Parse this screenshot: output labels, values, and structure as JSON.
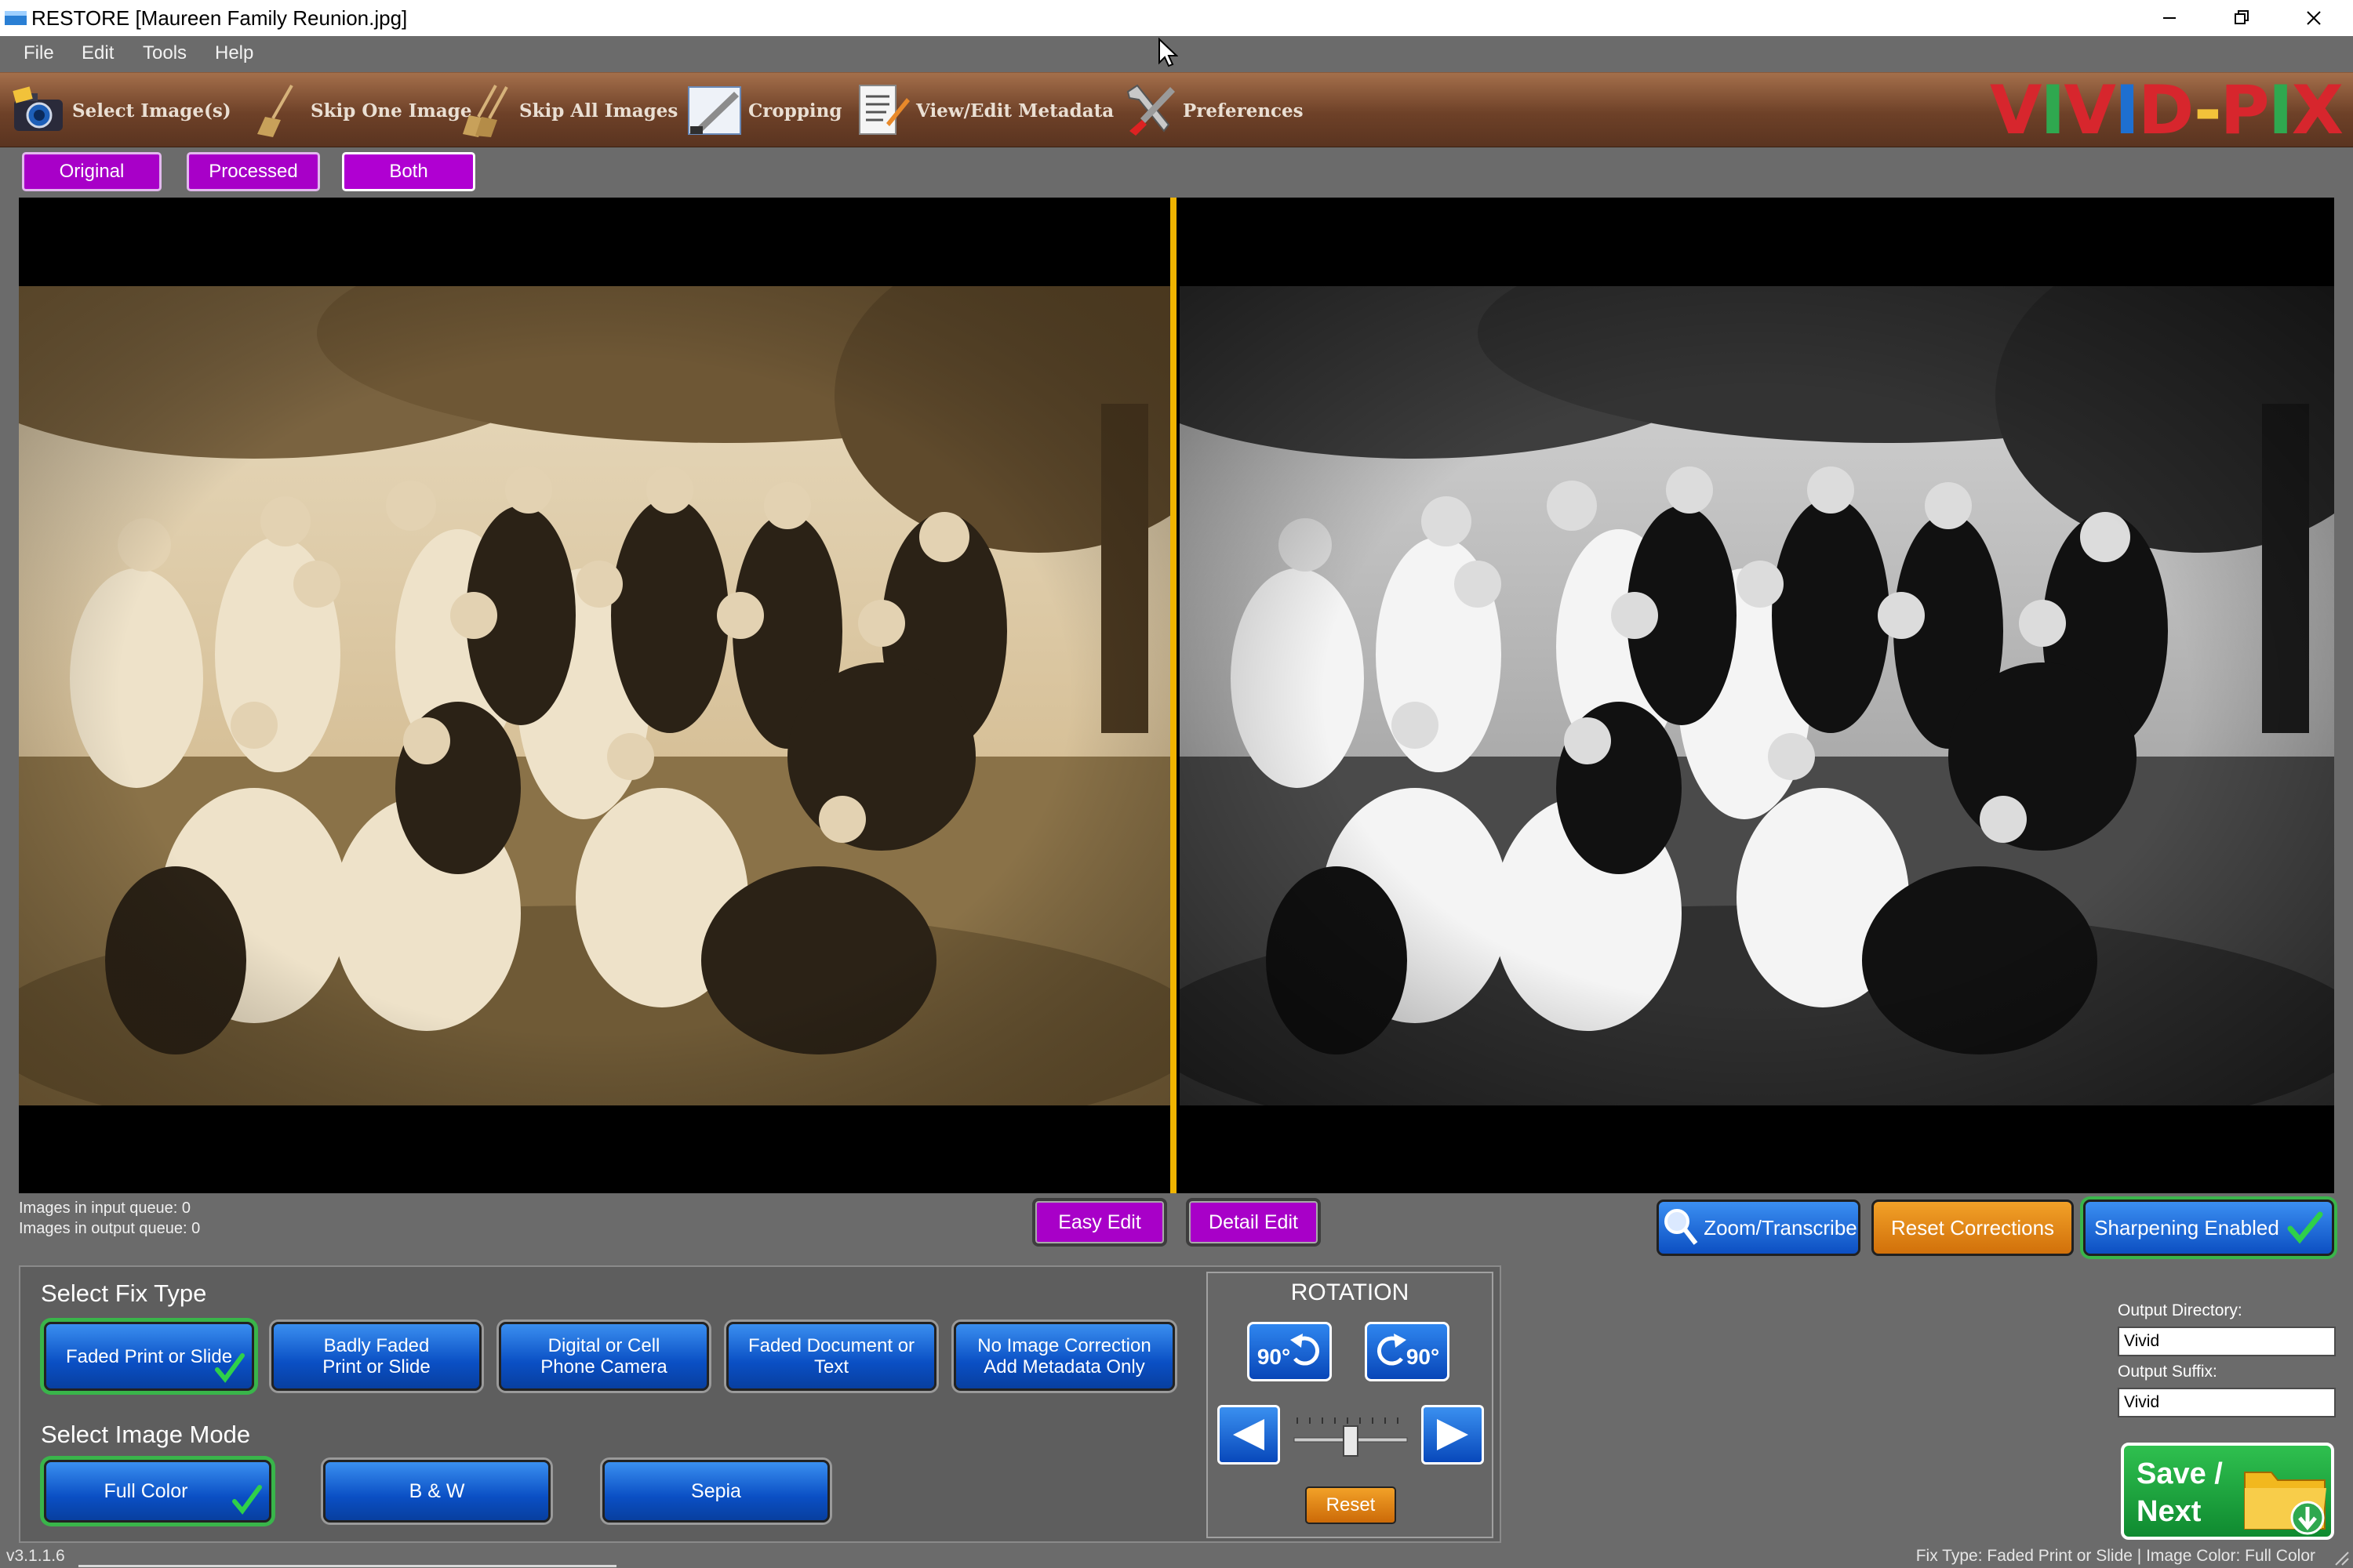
{
  "window": {
    "title": "RESTORE  [Maureen Family Reunion.jpg]"
  },
  "menu": [
    "File",
    "Edit",
    "Tools",
    "Help"
  ],
  "toolbar": {
    "items": [
      "Select Image(s)",
      "Skip One Image",
      "Skip All Images",
      "Cropping",
      "View/Edit Metadata",
      "Preferences"
    ],
    "brand": "VIVID-PIX"
  },
  "view_toggle": {
    "original": "Original",
    "processed": "Processed",
    "both": "Both",
    "active": "Both"
  },
  "queue": {
    "input": "Images in input queue:  0",
    "output": "Images in output queue: 0"
  },
  "edit_mode": {
    "easy": "Easy Edit",
    "detail": "Detail Edit"
  },
  "actions": {
    "zoom": "Zoom/Transcribe",
    "reset_corrections": "Reset Corrections",
    "sharpening": "Sharpening Enabled"
  },
  "fix_type": {
    "heading": "Select Fix Type",
    "options": [
      {
        "line1": "Faded Print or Slide",
        "line2": ""
      },
      {
        "line1": "Badly Faded",
        "line2": "Print or Slide"
      },
      {
        "line1": "Digital or Cell",
        "line2": "Phone Camera"
      },
      {
        "line1": "Faded Document or",
        "line2": "Text"
      },
      {
        "line1": "No Image Correction",
        "line2": "Add Metadata Only"
      }
    ],
    "selected": "Faded Print or Slide"
  },
  "image_mode": {
    "heading": "Select Image Mode",
    "options": [
      "Full Color",
      "B & W",
      "Sepia"
    ],
    "selected": "Full Color"
  },
  "rotation": {
    "heading": "ROTATION",
    "ccw_label": "90°",
    "cw_label": "90°",
    "reset": "Reset",
    "slider_level": 0.5
  },
  "output": {
    "directory_label": "Output Directory:",
    "directory_value": "Vivid",
    "suffix_label": "Output Suffix:",
    "suffix_value": "Vivid"
  },
  "save": {
    "line1": "Save /",
    "line2": "Next"
  },
  "status": {
    "version": "v3.1.1.6",
    "fix_info": "Fix Type:  Faded Print or Slide | Image Color: Full Color"
  },
  "colors": {
    "accent_purple": "#a800c8",
    "brand_red": "#d7262d",
    "divider_yellow": "#f0b400",
    "sepia": "#c2a272"
  }
}
